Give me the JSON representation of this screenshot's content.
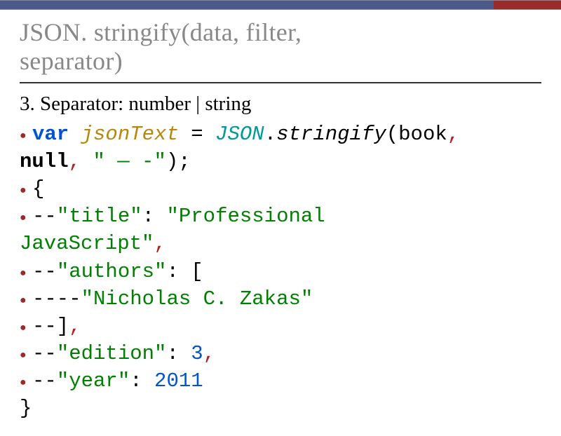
{
  "title_line1": "JSON. stringify(data, filter,",
  "title_line2": "separator)",
  "subhead": "3. Separator: number | string",
  "code": {
    "l1a": "var",
    "l1b": "jsonText",
    "l1c": "=",
    "l1d": "JSON",
    "l1e": ".",
    "l1f": "stringify",
    "l1g": "(book",
    "l1h": ",",
    "l2a": "null",
    "l2b": ",",
    "l2c": "\" — -\"",
    "l2d": ");",
    "l3": "{",
    "l4a": "--",
    "l4b": "\"title\"",
    "l4c": ":",
    "l4d": "\"Professional",
    "l5a": "JavaScript\"",
    "l5b": ",",
    "l6a": "--",
    "l6b": "\"authors\"",
    "l6c": ":",
    "l6d": "[",
    "l7a": "----",
    "l7b": "\"Nicholas C. Zakas\"",
    "l8a": "--]",
    "l8b": ",",
    "l9a": "--",
    "l9b": "\"edition\"",
    "l9c": ":",
    "l9d": "3",
    "l9e": ",",
    "l10a": "--",
    "l10b": "\"year\"",
    "l10c": ":",
    "l10d": "2011",
    "l11": "}"
  }
}
